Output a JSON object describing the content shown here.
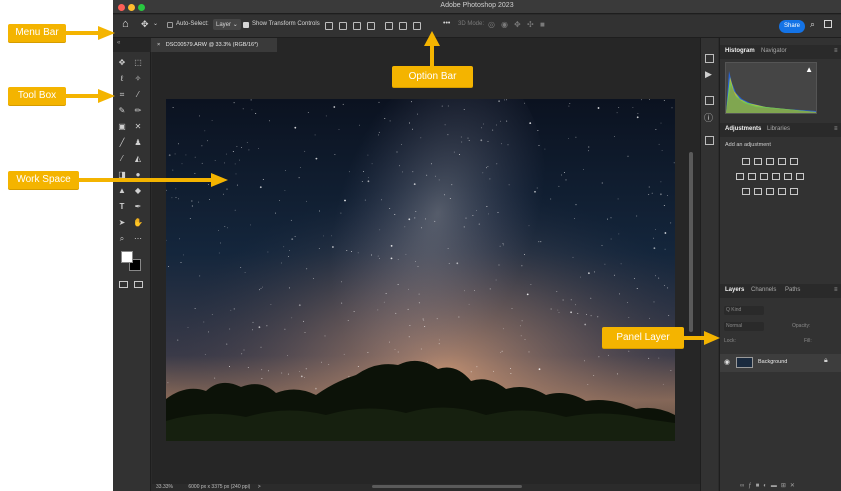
{
  "app": {
    "title": "Adobe Photoshop 2023",
    "traffic_light_colors": [
      "#ff5f57",
      "#febc2e",
      "#28c840"
    ]
  },
  "options_bar": {
    "auto_select_label": "Auto-Select:",
    "auto_select_value": "Layer",
    "transform_controls_label": "Show Transform Controls",
    "mode_3d_label": "3D Mode:",
    "more_label": "•••",
    "share_label": "Share"
  },
  "document_tab": {
    "label": "DSC00579.ARW @ 33.3% (RGB/16*)",
    "close_glyph": "×"
  },
  "status_bar": {
    "zoom": "33.33%",
    "doc_info": "6000 px x 3375 px (240 ppi)",
    "arrow": ">"
  },
  "panels": {
    "top_tabs": [
      "Histogram",
      "Navigator"
    ],
    "adjust_tabs": [
      "Adjustments",
      "Libraries"
    ],
    "add_adjustment_label": "Add an adjustment",
    "layer_tabs": [
      "Layers",
      "Channels",
      "Paths"
    ],
    "layers_filter_placeholder": "Q Kind",
    "layers_mode": "Normal",
    "opacity_label": "Opacity:",
    "lock_label": "Lock:",
    "fill_label": "Fill:",
    "background_layer_name": "Background"
  },
  "callouts": {
    "menu_bar": "Menu Bar",
    "tool_box": "Tool Box",
    "work_space": "Work Space",
    "option_bar": "Option Bar",
    "panel_layer": "Panel Layer"
  },
  "colors": {
    "callout": "#f4b400",
    "share_button": "#1473e6",
    "ui_dark": "#323232"
  }
}
